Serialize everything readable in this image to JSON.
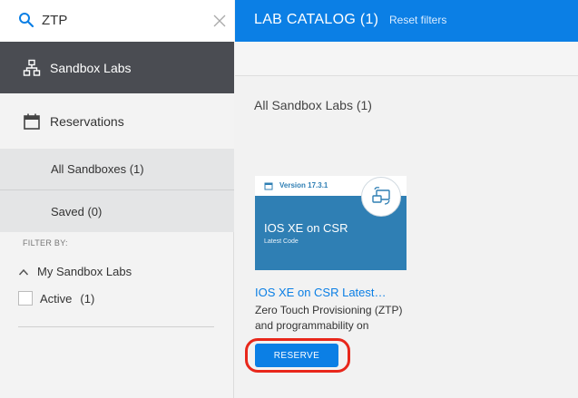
{
  "search": {
    "value": "ZTP",
    "icon": "search-icon",
    "clear_icon": "close-icon"
  },
  "sidebar": {
    "nav": [
      {
        "label": "Sandbox Labs",
        "icon": "hierarchy-icon",
        "active": true
      },
      {
        "label": "Reservations",
        "icon": "calendar-icon",
        "active": false
      }
    ],
    "sub_items": [
      {
        "label": "All Sandboxes (1)"
      },
      {
        "label": "Saved (0)"
      }
    ],
    "filter_heading": "FILTER BY:",
    "filter_group": {
      "label": "My Sandbox Labs",
      "icon": "chevron-up-icon"
    },
    "filter_option": {
      "label": "Active",
      "count": "(1)",
      "checked": false
    }
  },
  "header": {
    "title": "LAB CATALOG (1)",
    "reset_label": "Reset filters"
  },
  "main": {
    "section_title": "All Sandbox Labs (1)"
  },
  "card": {
    "version": "Version 17.3.1",
    "image_title": "IOS XE on CSR",
    "image_subtitle": "Latest Code",
    "title": "IOS XE on CSR Latest…",
    "description": "Zero Touch Provisioning (ZTP) and programmability on",
    "reserve_label": "RESERVE"
  },
  "colors": {
    "accent": "#0b7fe5",
    "sidebar_active": "#4a4c52",
    "highlight": "#e8271b",
    "card_image": "#2f7fb4"
  }
}
